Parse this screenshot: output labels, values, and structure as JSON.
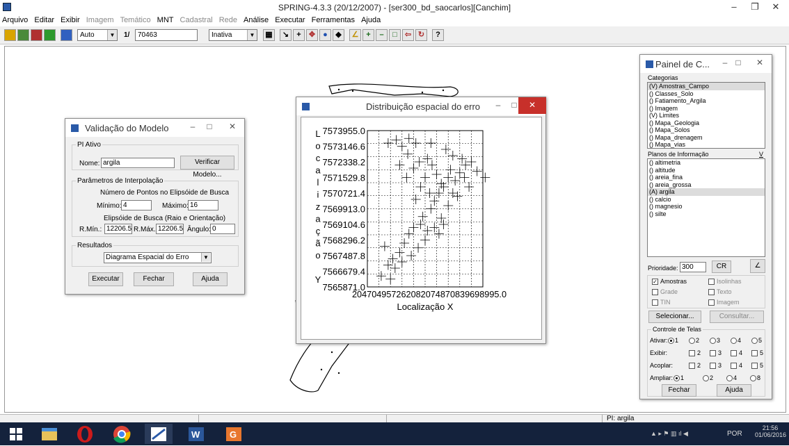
{
  "app": {
    "title": "SPRING-4.3.3 (20/12/2007) - [ser300_bd_saocarlos][Canchim]"
  },
  "menu": [
    {
      "label": "Arquivo",
      "enabled": true
    },
    {
      "label": "Editar",
      "enabled": true
    },
    {
      "label": "Exibir",
      "enabled": true
    },
    {
      "label": "Imagem",
      "enabled": false
    },
    {
      "label": "Temático",
      "enabled": false
    },
    {
      "label": "MNT",
      "enabled": true
    },
    {
      "label": "Cadastral",
      "enabled": false
    },
    {
      "label": "Rede",
      "enabled": false
    },
    {
      "label": "Análise",
      "enabled": true
    },
    {
      "label": "Executar",
      "enabled": true
    },
    {
      "label": "Ferramentas",
      "enabled": true
    },
    {
      "label": "Ajuda",
      "enabled": true
    }
  ],
  "toolbar": {
    "zoom_mode": "Auto",
    "scale_prefix": "1/",
    "scale_value": "70463",
    "mode_select": "Inativa"
  },
  "validacao": {
    "title": "Validação do Modelo",
    "pi_group": "PI Ativo",
    "nome_label": "Nome:",
    "nome_value": "argila",
    "verificar": "Verificar Modelo...",
    "param_group": "Parâmetros de Interpolação",
    "n_pontos": "Número de Pontos no Elipsóide de Busca",
    "minimo_label": "Mínimo:",
    "minimo_value": "4",
    "maximo_label": "Máximo:",
    "maximo_value": "16",
    "elipsoide": "Elipsóide de Busca (Raio e Orientação)",
    "rmin_label": "R.Mín.:",
    "rmin_value": "12206.5",
    "rmax_label": "R.Máx.:",
    "rmax_value": "12206.5",
    "angulo_label": "Ângulo:",
    "angulo_value": "0",
    "resultados_group": "Resultados",
    "resultado_select": "Diagrama Espacial do Erro",
    "executar": "Executar",
    "fechar": "Fechar",
    "ajuda": "Ajuda"
  },
  "distrib": {
    "title": "Distribuição espacial do erro",
    "ylabel_chars": [
      "L",
      "o",
      "c",
      "a",
      "l",
      "i",
      "z",
      "a",
      "ç",
      "ã",
      "o",
      "",
      "Y"
    ],
    "xlabel": "Localização X",
    "x_tick_text": "204704957262082074870839698995.0"
  },
  "chart_data": {
    "type": "scatter",
    "title": "Distribuição espacial do erro",
    "xlabel": "Localização X",
    "ylabel": "Localização Y",
    "y_ticks": [
      "7573955.0",
      "7573146.6",
      "7572338.2",
      "7571529.8",
      "7570721.4",
      "7569913.0",
      "7569104.6",
      "7568296.2",
      "7567487.8",
      "7566679.4",
      "7565871.0"
    ],
    "ylim": [
      7565871.0,
      7573955.0
    ],
    "grid": true,
    "points": [
      [
        0.12,
        0.93
      ],
      [
        0.18,
        0.86
      ],
      [
        0.22,
        0.82
      ],
      [
        0.28,
        0.78
      ],
      [
        0.15,
        0.74
      ],
      [
        0.32,
        0.72
      ],
      [
        0.36,
        0.66
      ],
      [
        0.4,
        0.62
      ],
      [
        0.46,
        0.6
      ],
      [
        0.52,
        0.64
      ],
      [
        0.48,
        0.55
      ],
      [
        0.55,
        0.5
      ],
      [
        0.58,
        0.45
      ],
      [
        0.62,
        0.4
      ],
      [
        0.66,
        0.36
      ],
      [
        0.7,
        0.3
      ],
      [
        0.72,
        0.25
      ],
      [
        0.76,
        0.32
      ],
      [
        0.8,
        0.27
      ],
      [
        0.85,
        0.22
      ],
      [
        0.6,
        0.28
      ],
      [
        0.56,
        0.22
      ],
      [
        0.52,
        0.18
      ],
      [
        0.45,
        0.2
      ],
      [
        0.4,
        0.24
      ],
      [
        0.35,
        0.15
      ],
      [
        0.3,
        0.1
      ],
      [
        0.25,
        0.06
      ],
      [
        0.36,
        0.05
      ],
      [
        0.42,
        0.08
      ],
      [
        0.68,
        0.12
      ],
      [
        0.74,
        0.16
      ],
      [
        0.82,
        0.18
      ],
      [
        0.9,
        0.2
      ],
      [
        0.95,
        0.26
      ],
      [
        1.02,
        0.3
      ],
      [
        0.88,
        0.36
      ],
      [
        0.78,
        0.42
      ],
      [
        0.7,
        0.48
      ],
      [
        0.64,
        0.56
      ],
      [
        0.58,
        0.62
      ],
      [
        0.5,
        0.7
      ],
      [
        0.44,
        0.75
      ],
      [
        0.38,
        0.8
      ],
      [
        0.3,
        0.84
      ],
      [
        0.24,
        0.88
      ],
      [
        0.2,
        0.95
      ],
      [
        0.62,
        0.66
      ],
      [
        0.66,
        0.6
      ],
      [
        0.54,
        0.4
      ],
      [
        0.46,
        0.36
      ],
      [
        0.42,
        0.44
      ],
      [
        0.5,
        0.3
      ],
      [
        0.64,
        0.34
      ],
      [
        0.74,
        0.4
      ],
      [
        0.84,
        0.3
      ],
      [
        0.34,
        0.3
      ],
      [
        0.28,
        0.22
      ],
      [
        0.18,
        0.08
      ],
      [
        0.55,
        0.08
      ]
    ]
  },
  "painel": {
    "title": "Painel de C...",
    "categorias_label": "Categorias",
    "categorias": [
      {
        "label": "(V) Amostras_Campo",
        "sel": true
      },
      {
        "label": "() Classes_Solo",
        "sel": false
      },
      {
        "label": "() Fatiamento_Argila",
        "sel": false
      },
      {
        "label": "() Imagem",
        "sel": false
      },
      {
        "label": "(V) Limites",
        "sel": false
      },
      {
        "label": "() Mapa_Geologia",
        "sel": false
      },
      {
        "label": "() Mapa_Solos",
        "sel": false
      },
      {
        "label": "() Mapa_drenagem",
        "sel": false
      },
      {
        "label": "() Mapa_vias",
        "sel": false
      }
    ],
    "planos_label": "Planos de Informação",
    "planos_v": "V",
    "planos": [
      {
        "label": "() altimetria",
        "sel": false
      },
      {
        "label": "() altitude",
        "sel": false
      },
      {
        "label": "() areia_fina",
        "sel": false
      },
      {
        "label": "() areia_grossa",
        "sel": false
      },
      {
        "label": "(A) argila",
        "sel": true
      },
      {
        "label": "() calcio",
        "sel": false
      },
      {
        "label": "() magnesio",
        "sel": false
      },
      {
        "label": "() silte",
        "sel": false
      }
    ],
    "prioridade_label": "Prioridade:",
    "prioridade_value": "300",
    "cr": "CR",
    "cb_amostras": "Amostras",
    "cb_isolinhas": "Isolinhas",
    "cb_grade": "Grade",
    "cb_texto": "Texto",
    "cb_tin": "TIN",
    "cb_imagem": "Imagem",
    "selecionar": "Selecionar...",
    "consultar": "Consultar...",
    "controle_label": "Controle de Telas",
    "ativar_label": "Ativar:",
    "exibir_label": "Exibir:",
    "acoplar_label": "Acoplar:",
    "ampliar_label": "Ampliar:",
    "n1": "1",
    "n2": "2",
    "n3": "3",
    "n4": "4",
    "n5": "5",
    "n8": "8",
    "fechar": "Fechar",
    "ajuda": "Ajuda"
  },
  "status": {
    "pi": "PI: argila"
  },
  "taskbar": {
    "lang": "POR",
    "time": "21:56",
    "date": "01/06/2016"
  }
}
